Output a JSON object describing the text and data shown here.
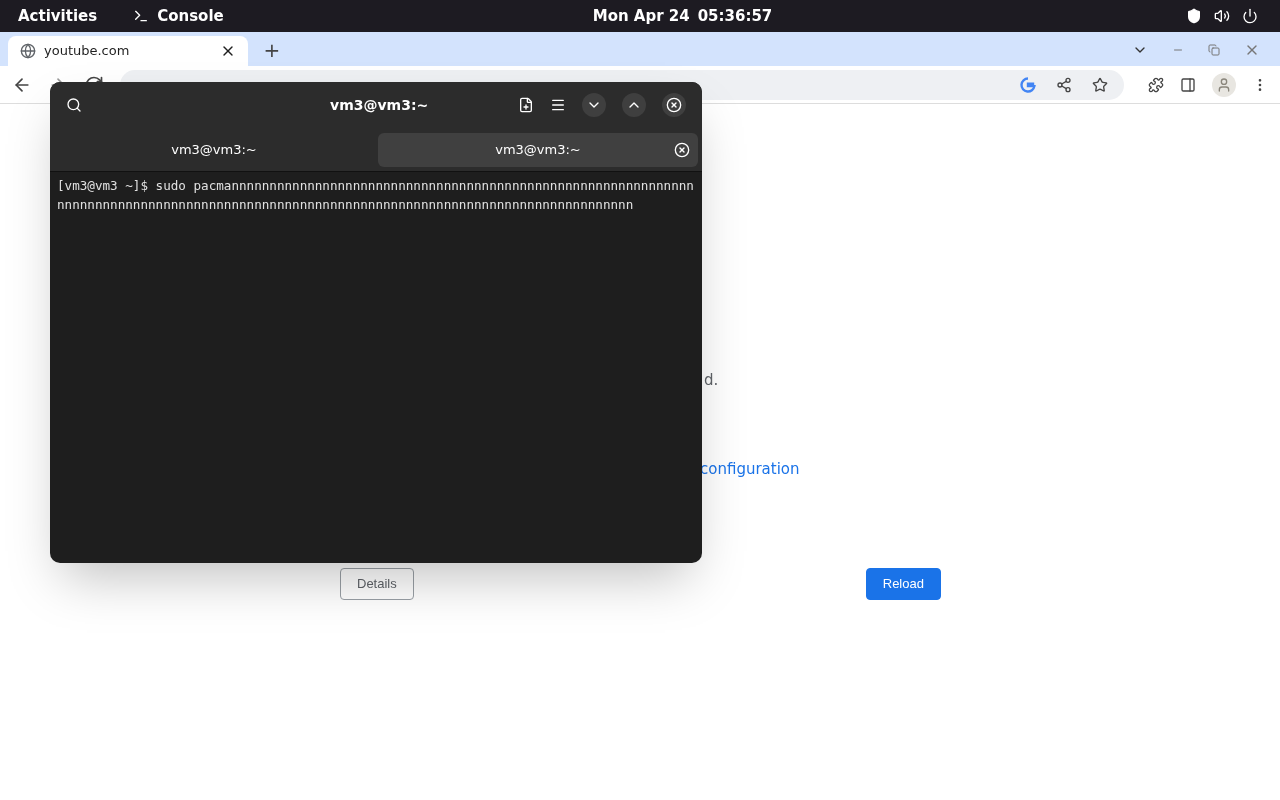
{
  "top_bar": {
    "activities": "Activities",
    "app": "Console",
    "date": "Mon Apr 24",
    "time": "05:36:57"
  },
  "browser": {
    "tabs": [
      {
        "title": "youtube.com",
        "selected": true
      }
    ],
    "new_tab": "+"
  },
  "page": {
    "text_fragment": "d.",
    "link_fragment": "configuration",
    "buttons": [
      {
        "label": "Details",
        "kind": "secondary"
      },
      {
        "label": "Reload",
        "kind": "primary"
      }
    ]
  },
  "terminal": {
    "title": "vm3@vm3:~",
    "tabs": [
      {
        "label": "vm3@vm3:~",
        "selected": false
      },
      {
        "label": "vm3@vm3:~",
        "selected": true
      }
    ],
    "output": "[vm3@vm3 ~]$ sudo pacmannnnnnnnnnnnnnnnnnnnnnnnnnnnnnnnnnnnnnnnnnnnnnnnnnnnnnnnnnnnnnnnnnnnnnnnnnnnnnnnnnnnnnnnnnnnnnnnnnnnnnnnnnnnnnnnnnnnnnnnnnnnnnnnnnnnnnnnn"
  }
}
